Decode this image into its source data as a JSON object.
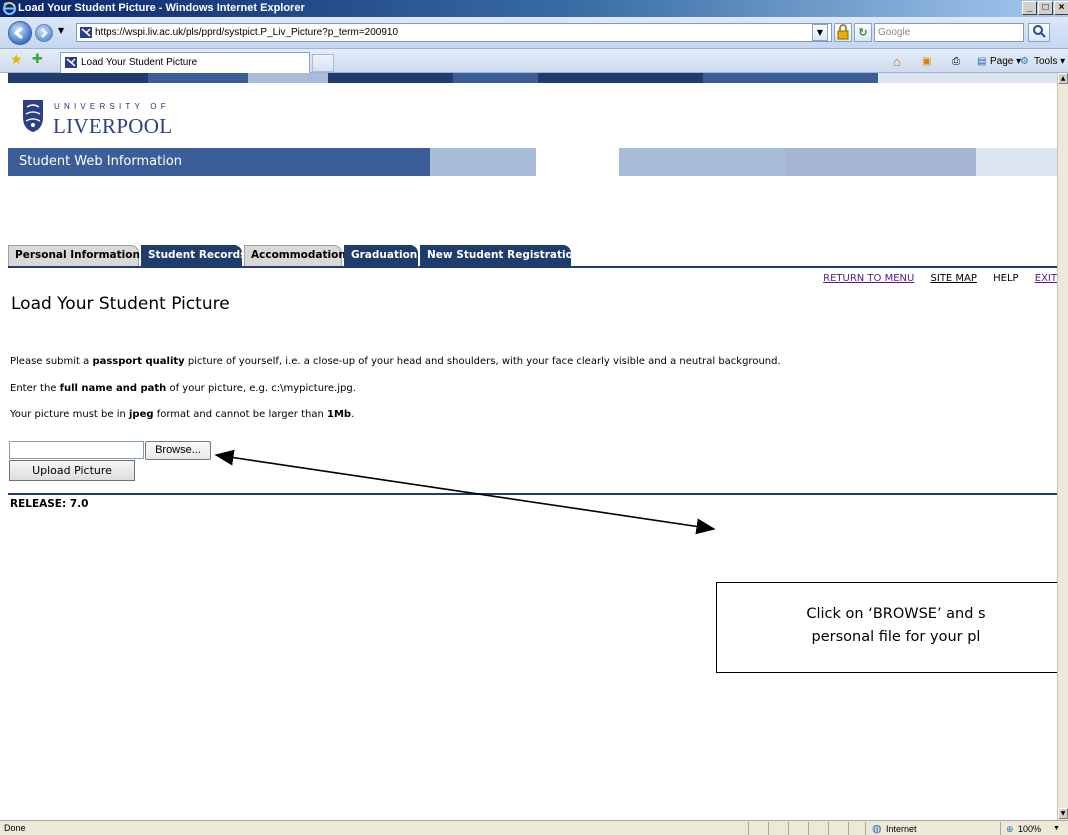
{
  "window": {
    "title": "Load Your Student Picture - Windows Internet Explorer",
    "controls": [
      "_",
      "□",
      "×"
    ]
  },
  "browser": {
    "url": "https://wspi.liv.ac.uk/pls/pprd/systpict.P_Liv_Picture?p_term=200910",
    "search_placeholder": "Google",
    "tab_title": "Load Your Student Picture",
    "page_menu": "Page",
    "tools_menu": "Tools",
    "icons": [
      "back-icon",
      "forward-icon",
      "lock-icon",
      "refresh-icon",
      "stop-icon",
      "search-icon",
      "favorites-star-icon",
      "add-favorites-icon",
      "home-icon",
      "feeds-icon",
      "print-icon"
    ]
  },
  "site": {
    "university_of": "UNIVERSITY OF",
    "university_name": "LIVERPOOL",
    "banner_title": "Student Web Information",
    "nav_tabs": [
      {
        "label": "Personal Information",
        "style": "grey"
      },
      {
        "label": "Student Records",
        "style": "blue"
      },
      {
        "label": "Accommodation",
        "style": "grey"
      },
      {
        "label": "Graduation",
        "style": "blue"
      },
      {
        "label": "New Student Registration",
        "style": "blue"
      }
    ],
    "top_links": {
      "menu": "RETURN TO MENU",
      "sitemap": "SITE MAP",
      "help": "HELP",
      "exit": "EXIT"
    },
    "colors": {
      "brand_blue": "#3c5e98",
      "nav_dark": "#1f3c6c",
      "light_blue": "#a9bcda",
      "pale_blue": "#dde5f0"
    }
  },
  "page": {
    "title": "Load Your Student Picture",
    "p1": {
      "a": "Please submit a ",
      "b": "passport quality",
      "c": " picture of yourself, i.e. a close-up of your head and shoulders, with your face clearly visible and a neutral background."
    },
    "p2": {
      "a": "Enter the ",
      "b": "full name and path",
      "c": " of your picture, e.g. c:\\mypicture.jpg."
    },
    "p3": {
      "a": "Your picture must be in ",
      "b": "jpeg",
      "c": " format and cannot be larger than ",
      "d": "1Mb",
      "e": "."
    },
    "file_value": "",
    "browse_label": "Browse...",
    "upload_label": "Upload Picture",
    "release": "RELEASE: 7.0"
  },
  "callout": {
    "line1": "Click on ‘BROWSE’ and s",
    "line2": "personal file for your pl"
  },
  "status": {
    "left": "Done",
    "zone": "Internet",
    "zoom": "100%"
  }
}
